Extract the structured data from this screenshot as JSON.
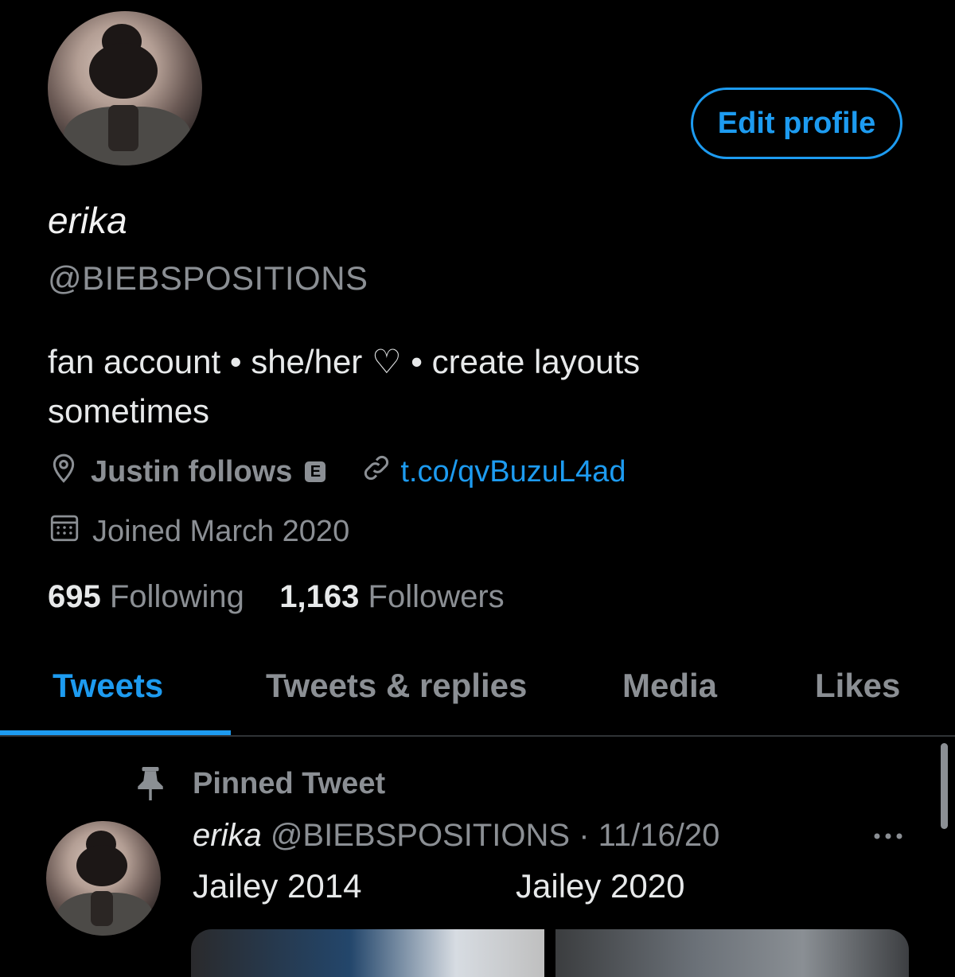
{
  "profile": {
    "display_name": "erika",
    "handle": "@BIEBSPOSITIONS",
    "edit_button": "Edit profile",
    "bio": "fan account • she/her ♡ • create layouts sometimes",
    "location": "Justin follows",
    "location_badge": "E",
    "link": "t.co/qvBuzuL4ad",
    "joined": "Joined March 2020",
    "following_count": "695",
    "following_label": "Following",
    "followers_count": "1,163",
    "followers_label": "Followers"
  },
  "tabs": [
    {
      "label": "Tweets",
      "active": true
    },
    {
      "label": "Tweets & replies",
      "active": false
    },
    {
      "label": "Media",
      "active": false
    },
    {
      "label": "Likes",
      "active": false
    }
  ],
  "pinned_tweet": {
    "pinned_label": "Pinned Tweet",
    "author_name": "erika",
    "author_handle": "@BIEBSPOSITIONS",
    "date": "· 11/16/20",
    "text_left": "Jailey 2014",
    "text_right": "Jailey 2020"
  },
  "colors": {
    "background": "#000000",
    "accent": "#1d9bf0",
    "secondary_text": "#8b8f94",
    "primary_text": "#e7e9ea"
  },
  "icons": [
    "location-pin-icon",
    "link-icon",
    "calendar-icon",
    "pin-icon",
    "more-dots-icon"
  ]
}
